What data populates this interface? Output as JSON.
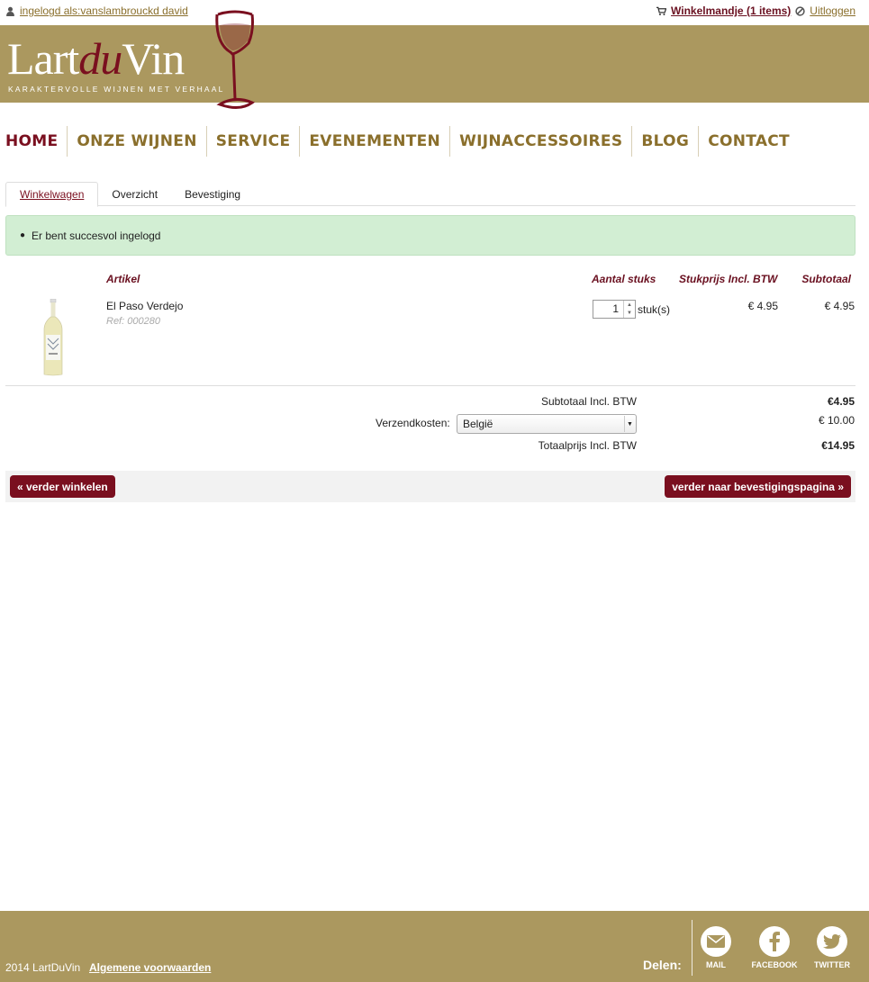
{
  "topbar": {
    "login_text": "ingelogd als:vanslambrouckd david",
    "cart_text": "Winkelmandje (1 items)",
    "logout_text": "Uitloggen"
  },
  "header": {
    "logo_part1": "Lart",
    "logo_part2": "du",
    "logo_part3": "Vin",
    "tagline": "KARAKTERVOLLE WIJNEN MET VERHAAL"
  },
  "nav": {
    "items": [
      "HOME",
      "ONZE WIJNEN",
      "SERVICE",
      "EVENEMENTEN",
      "WIJNACCESSOIRES",
      "BLOG",
      "CONTACT"
    ]
  },
  "steps": {
    "items": [
      "Winkelwagen",
      "Overzicht",
      "Bevestiging"
    ]
  },
  "alert": {
    "message": "Er bent succesvol ingelogd"
  },
  "cart": {
    "headers": {
      "article": "Artikel",
      "quantity": "Aantal stuks",
      "unit_price": "Stukprijs Incl. BTW",
      "subtotal": "Subtotaal"
    },
    "items": [
      {
        "name": "El Paso Verdejo",
        "ref": "Ref: 000280",
        "quantity": "1",
        "unit": "stuk(s)",
        "unit_price": "€ 4.95",
        "subtotal": "€ 4.95"
      }
    ]
  },
  "summary": {
    "subtotal_label": "Subtotaal Incl. BTW",
    "subtotal_value": "€4.95",
    "shipping_label": "Verzendkosten:",
    "shipping_country": "België",
    "shipping_value": "€ 10.00",
    "total_label": "Totaalprijs Incl. BTW",
    "total_value": "€14.95"
  },
  "actions": {
    "continue_shopping": "« verder winkelen",
    "continue_confirm": "verder naar bevestigingspagina  »"
  },
  "footer": {
    "copyright": "2014 LartDuVin",
    "terms": "Algemene voorwaarden",
    "share_label": "Delen:",
    "social": [
      "MAIL",
      "FACEBOOK",
      "TWITTER"
    ]
  },
  "colors": {
    "brand_gold": "#ab985f",
    "brand_wine": "#7a0f1f",
    "success_bg": "#d2eed3"
  }
}
